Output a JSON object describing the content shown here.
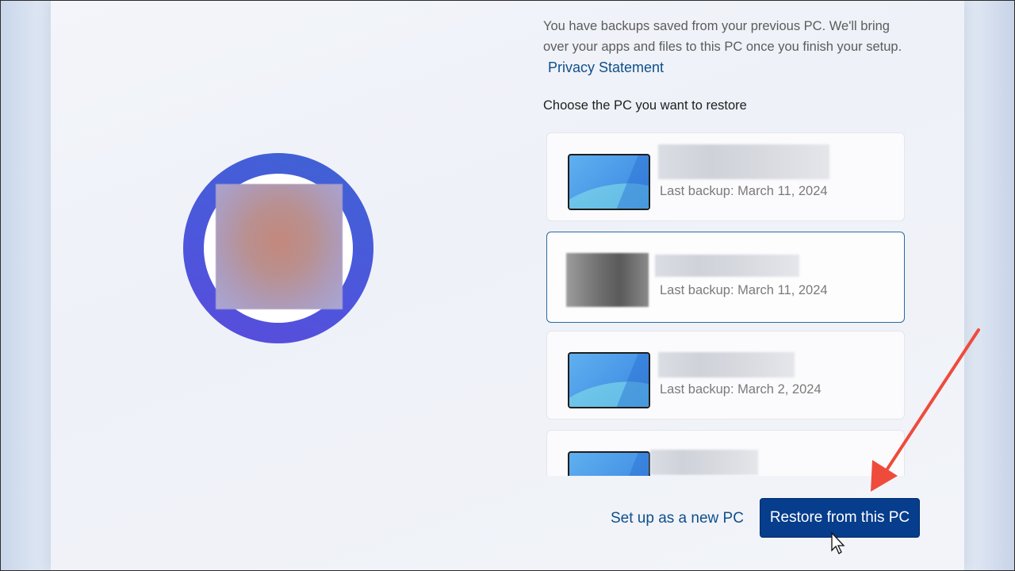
{
  "intro": {
    "text": "You have backups saved from your previous PC. We'll bring over your apps and files to this PC once you finish your setup.",
    "privacy_link": "Privacy Statement"
  },
  "choose_label": "Choose the PC you want to restore",
  "backups": [
    {
      "last_backup": "Last backup: March 11, 2024",
      "thumbnail": "laptop-wallpaper-icon",
      "selected": false
    },
    {
      "last_backup": "Last backup: March 11, 2024",
      "thumbnail": "blurred-photo",
      "selected": true
    },
    {
      "last_backup": "Last backup: March 2, 2024",
      "thumbnail": "laptop-wallpaper-icon",
      "selected": false
    },
    {
      "last_backup": "",
      "thumbnail": "laptop-wallpaper-icon",
      "selected": false
    }
  ],
  "actions": {
    "setup_new": "Set up as a new PC",
    "restore": "Restore from this PC"
  },
  "colors": {
    "accent": "#063d8c",
    "link": "#0f4f8a",
    "selected_border": "#2a6aa0",
    "annotation_arrow": "#ef4b3c",
    "avatar_ring": "#4d56dc"
  }
}
